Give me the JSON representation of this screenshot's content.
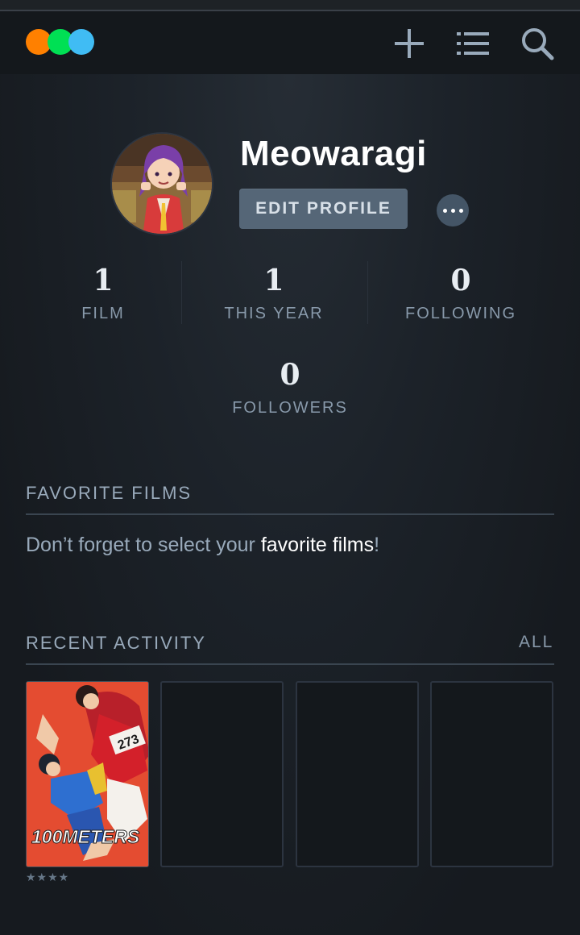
{
  "nav": {
    "logo_colors": [
      "#ff8000",
      "#00e054",
      "#40bcf4"
    ],
    "icons": [
      "plus-icon",
      "list-icon",
      "search-icon"
    ]
  },
  "profile": {
    "username": "Meowaragi",
    "edit_label": "EDIT PROFILE",
    "more_icon": "ellipsis-icon"
  },
  "stats": [
    {
      "value": "1",
      "label": "FILM"
    },
    {
      "value": "1",
      "label": "THIS YEAR"
    },
    {
      "value": "0",
      "label": "FOLLOWING"
    },
    {
      "value": "0",
      "label": "FOLLOWERS"
    }
  ],
  "favorites": {
    "title": "FAVORITE FILMS",
    "text_before": "Don’t forget to select your ",
    "link": "favorite films",
    "text_after": "!"
  },
  "activity": {
    "title": "RECENT ACTIVITY",
    "all_label": "ALL",
    "items": [
      {
        "poster_title": "100METERS",
        "rating": "★★★★"
      },
      {
        "poster_title": ""
      },
      {
        "poster_title": ""
      },
      {
        "poster_title": ""
      }
    ]
  },
  "colors": {
    "background": "#14181c",
    "accent_orange": "#ff8000",
    "accent_green": "#00e054",
    "accent_blue": "#40bcf4"
  }
}
